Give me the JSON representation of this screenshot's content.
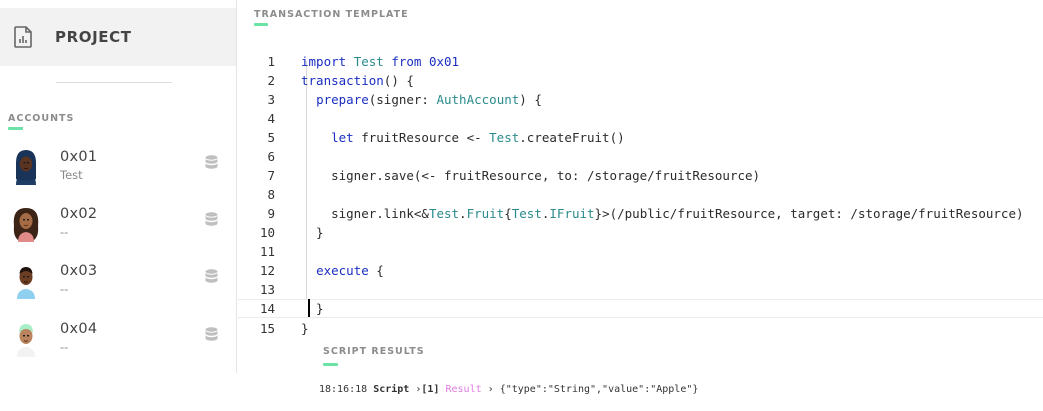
{
  "sidebar": {
    "project_label": "PROJECT",
    "accounts_title": "ACCOUNTS",
    "accounts": [
      {
        "address": "0x01",
        "name": "Test"
      },
      {
        "address": "0x02",
        "name": "--"
      },
      {
        "address": "0x03",
        "name": "--"
      },
      {
        "address": "0x04",
        "name": "--"
      }
    ]
  },
  "editor": {
    "title": "TRANSACTION TEMPLATE",
    "line_numbers": [
      "1",
      "2",
      "3",
      "4",
      "5",
      "6",
      "7",
      "8",
      "9",
      "10",
      "11",
      "12",
      "13",
      "14",
      "15"
    ]
  },
  "results": {
    "title": "SCRIPT RESULTS",
    "time": "18:16:18",
    "label": "Script",
    "index": "[1]",
    "result_label": "Result",
    "value": "{\"type\":\"String\",\"value\":\"Apple\"}"
  },
  "colors": {
    "accent": "#6be3a6",
    "keyword": "#1a2fc2",
    "type": "#2a8b8b",
    "result": "#e07be0"
  }
}
